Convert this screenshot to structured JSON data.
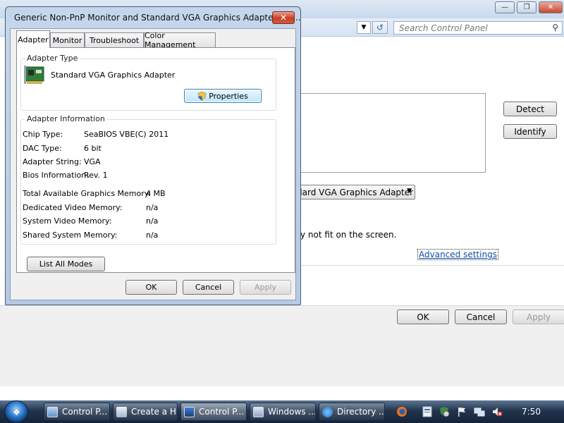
{
  "background_window": {
    "search_placeholder": "Search Control Panel",
    "detect_label": "Detect",
    "identify_label": "Identify",
    "display_select_value": "dard VGA Graphics Adapter",
    "fit_text": "y not fit on the screen.",
    "advanced_settings_label": "Advanced settings",
    "ok_label": "OK",
    "cancel_label": "Cancel",
    "apply_label": "Apply"
  },
  "dialog": {
    "title": "Generic Non-PnP Monitor and Standard VGA Graphics Adapter Pro...",
    "tabs": [
      {
        "label": "Adapter",
        "active": true
      },
      {
        "label": "Monitor",
        "active": false
      },
      {
        "label": "Troubleshoot",
        "active": false
      },
      {
        "label": "Color Management",
        "active": false
      }
    ],
    "adapter_type": {
      "group_label": "Adapter Type",
      "name": "Standard VGA Graphics Adapter",
      "properties_label": "Properties"
    },
    "adapter_info": {
      "group_label": "Adapter Information",
      "rows": [
        {
          "label": "Chip Type:",
          "value": "SeaBIOS VBE(C) 2011"
        },
        {
          "label": "DAC Type:",
          "value": "6 bit"
        },
        {
          "label": "Adapter String:",
          "value": "VGA"
        },
        {
          "label": "Bios Information:",
          "value": "Rev. 1"
        },
        {
          "label": "Total Available Graphics Memory:",
          "value": "4 MB"
        },
        {
          "label": "Dedicated Video Memory:",
          "value": "n/a"
        },
        {
          "label": "System Video Memory:",
          "value": "n/a"
        },
        {
          "label": "Shared System Memory:",
          "value": "n/a"
        }
      ]
    },
    "list_all_modes_label": "List All Modes",
    "ok_label": "OK",
    "cancel_label": "Cancel",
    "apply_label": "Apply"
  },
  "taskbar": {
    "tasks": [
      {
        "label": "Control P...",
        "icon": "control-panel-icon"
      },
      {
        "label": "Create a H...",
        "icon": "create-icon"
      },
      {
        "label": "Control P...",
        "icon": "display-icon"
      },
      {
        "label": "Windows ...",
        "icon": "windows-icon"
      },
      {
        "label": "Directory ...",
        "icon": "ie-icon"
      }
    ],
    "clock": "7:50"
  },
  "colors": {
    "dialog_frame": "#b5c9e3",
    "close_button": "#c63f25",
    "taskbar": "#22354d",
    "link": "#0f4fa8"
  }
}
